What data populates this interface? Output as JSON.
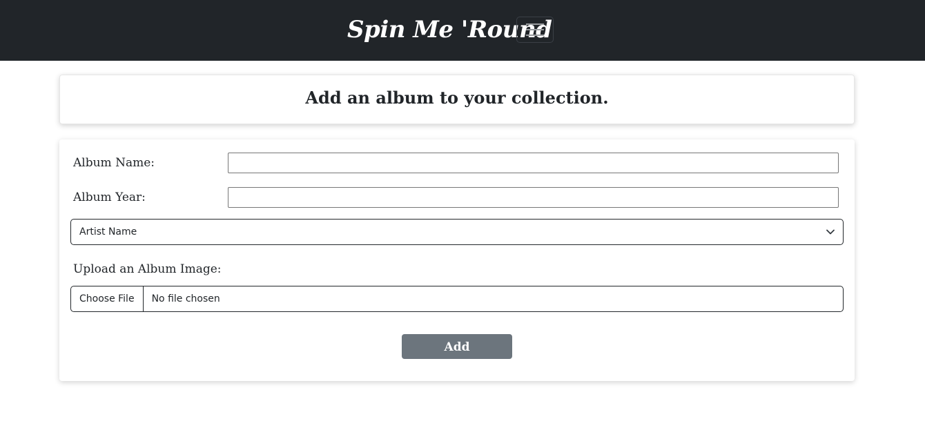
{
  "navbar": {
    "brand": "Spin Me 'Round",
    "toggler_icon": "hamburger-menu-icon"
  },
  "header": {
    "title": "Add an album to your collection."
  },
  "form": {
    "album_name_label": "Album Name:",
    "album_name_value": "",
    "album_year_label": "Album Year:",
    "album_year_value": "",
    "artist_select_value": "Artist Name",
    "artist_select_icon": "chevron-down-icon",
    "upload_label": "Upload an Album Image:",
    "file_button": "Choose File",
    "file_status": "No file chosen",
    "submit_label": "Add"
  },
  "colors": {
    "navbar_bg": "#212529",
    "button_bg": "#6c757d"
  }
}
